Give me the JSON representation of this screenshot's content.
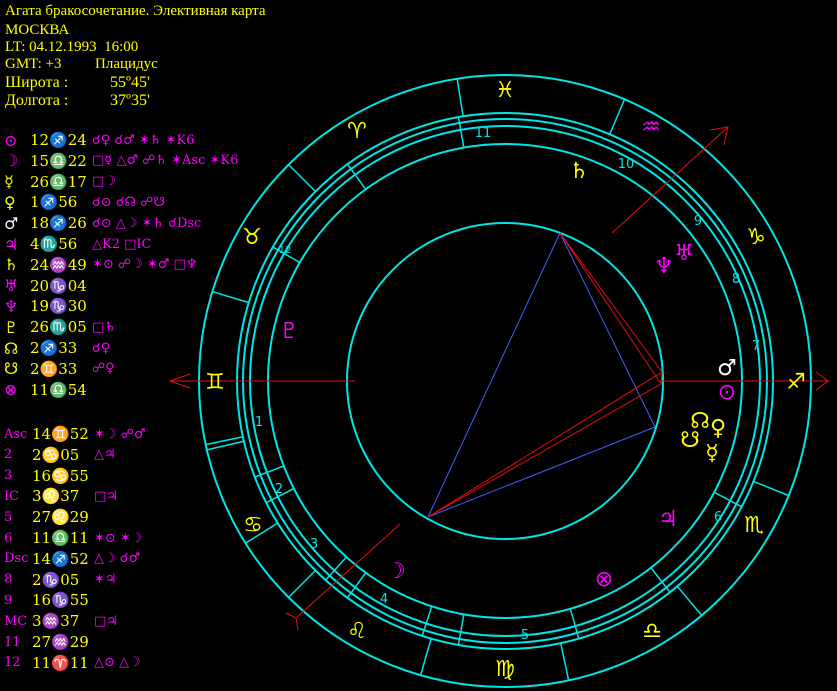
{
  "header": {
    "title": "Агата бракосочетание. Элективная карта",
    "city": "МОСКВА",
    "lt": "LT: 04.12.1993  16:00",
    "gmt": "GMT: +3",
    "system": "Плацидус",
    "lat_label": "Широта :",
    "lat_value": "55º45'",
    "lon_label": "Долгота :",
    "lon_value": "37º35'"
  },
  "planets": [
    {
      "glyph": "⊙",
      "pos": "12♐24",
      "aspects": "☌♀ ☌♂ ✶♄ ✶K6",
      "color": "#ff00ff"
    },
    {
      "glyph": "☽",
      "pos": "15♎22",
      "aspects": "□☿ △♂ ☍♄ ✶Asc ✶K6",
      "color": "#ff00ff"
    },
    {
      "glyph": "☿",
      "pos": "26♎17",
      "aspects": "□☽",
      "color": "#ffff00"
    },
    {
      "glyph": "♀",
      "pos": "1♐56",
      "aspects": "☌⊙ ☌☊ ☍☋",
      "color": "#ffff00"
    },
    {
      "glyph": "♂",
      "pos": "18♐26",
      "aspects": "☌⊙ △☽ ✶♄ ☌Dsc",
      "color": "#ffffff"
    },
    {
      "glyph": "♃",
      "pos": "4♏56",
      "aspects": "△K2 □IC",
      "color": "#ff00ff"
    },
    {
      "glyph": "♄",
      "pos": "24♒49",
      "aspects": "✶⊙ ☍☽ ✶♂ □♆",
      "color": "#ffff00"
    },
    {
      "glyph": "♅",
      "pos": "20♑04",
      "aspects": "",
      "color": "#ff00ff"
    },
    {
      "glyph": "♆",
      "pos": "19♑30",
      "aspects": "",
      "color": "#ff00ff"
    },
    {
      "glyph": "♇",
      "pos": "26♏05",
      "aspects": "□♄",
      "color": "#ffff00"
    },
    {
      "glyph": "☊",
      "pos": "2♐33",
      "aspects": "☌♀",
      "color": "#ffff00"
    },
    {
      "glyph": "☋",
      "pos": "2♊33",
      "aspects": "☍♀",
      "color": "#ffff00"
    },
    {
      "glyph": "⊗",
      "pos": "11♎54",
      "aspects": "",
      "color": "#ff00ff"
    }
  ],
  "cusps": [
    {
      "label": "Asc",
      "pos": "14♊52",
      "aspects": "✶☽ ☍♂"
    },
    {
      "label": "2",
      "pos": "2♋05",
      "aspects": "△♃"
    },
    {
      "label": "3",
      "pos": "16♋55",
      "aspects": ""
    },
    {
      "label": "IC",
      "pos": "3♌37",
      "aspects": "□♃"
    },
    {
      "label": "5",
      "pos": "27♌29",
      "aspects": ""
    },
    {
      "label": "6",
      "pos": "11♎11",
      "aspects": "✶⊙ ✶☽"
    },
    {
      "label": "Dsc",
      "pos": "14♐52",
      "aspects": "△☽ ☌♂"
    },
    {
      "label": "8",
      "pos": "2♑05",
      "aspects": "✶♃"
    },
    {
      "label": "9",
      "pos": "16♑55",
      "aspects": ""
    },
    {
      "label": "MC",
      "pos": "3♒37",
      "aspects": "□♃"
    },
    {
      "label": "11",
      "pos": "27♒29",
      "aspects": ""
    },
    {
      "label": "12",
      "pos": "11♈11",
      "aspects": "△⊙ △☽"
    }
  ],
  "wheel": {
    "signs": [
      {
        "glyph": "♓",
        "color": "#ffff00"
      },
      {
        "glyph": "♈",
        "color": "#ffff00"
      },
      {
        "glyph": "♒",
        "color": "#ff00ff"
      },
      {
        "glyph": "♉",
        "color": "#ffff00"
      },
      {
        "glyph": "♑",
        "color": "#ffff00"
      },
      {
        "glyph": "♊",
        "color": "#ffff00"
      },
      {
        "glyph": "♐",
        "color": "#ffff00"
      },
      {
        "glyph": "♋",
        "color": "#ffff00"
      },
      {
        "glyph": "♏",
        "color": "#ffff00"
      },
      {
        "glyph": "♌",
        "color": "#ffff00"
      },
      {
        "glyph": "♍",
        "color": "#ffff00"
      },
      {
        "glyph": "♎",
        "color": "#ffff00"
      }
    ],
    "house_numbers": [
      "1",
      "2",
      "3",
      "4",
      "5",
      "6",
      "7",
      "8",
      "9",
      "10",
      "11",
      "12"
    ],
    "planet_glyphs": [
      {
        "glyph": "♄",
        "color": "#ffff00"
      },
      {
        "glyph": "♆",
        "color": "#ff00ff"
      },
      {
        "glyph": "♅",
        "color": "#ff00ff"
      },
      {
        "glyph": "♇",
        "color": "#ff00ff"
      },
      {
        "glyph": "♂",
        "color": "#ffffff"
      },
      {
        "glyph": "⊙",
        "color": "#ff00ff"
      },
      {
        "glyph": "☊",
        "color": "#ffff00"
      },
      {
        "glyph": "♀",
        "color": "#ffff00"
      },
      {
        "glyph": "☋",
        "color": "#ffff00"
      },
      {
        "glyph": "☿",
        "color": "#ffff00"
      },
      {
        "glyph": "♃",
        "color": "#ff00ff"
      },
      {
        "glyph": "⊗",
        "color": "#ff00ff"
      },
      {
        "glyph": "☽",
        "color": "#ff00ff"
      }
    ]
  }
}
